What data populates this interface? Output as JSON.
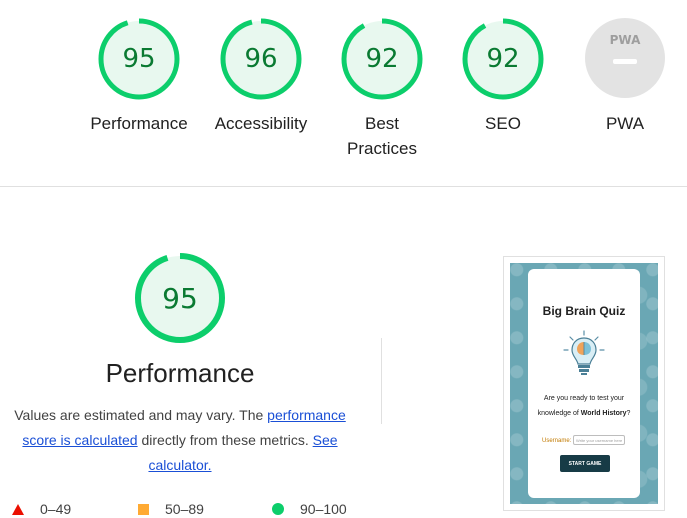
{
  "summary": {
    "gauges": [
      {
        "label": "Performance",
        "score": 95
      },
      {
        "label": "Accessibility",
        "score": 96
      },
      {
        "label": "Best Practices",
        "label_lines": [
          "Best",
          "Practices"
        ],
        "score": 92
      },
      {
        "label": "SEO",
        "score": 92
      }
    ],
    "pwa": {
      "badge_text": "PWA",
      "label": "PWA"
    }
  },
  "performance": {
    "score": 95,
    "title": "Performance",
    "desc_prefix": "Values are estimated and may vary. The ",
    "desc_link_text": "performance score is calculated",
    "desc_middle": " directly from these metrics. ",
    "calc_link_text": "See calculator.",
    "legend": [
      {
        "icon": "triangle-icon",
        "range": "0–49",
        "color": "#eb0f00"
      },
      {
        "icon": "square-icon",
        "range": "50–89",
        "color": "#ffaa33"
      },
      {
        "icon": "circle-icon",
        "range": "90–100",
        "color": "#0cce6b"
      }
    ]
  },
  "screenshot": {
    "title": "Big Brain Quiz",
    "question_prefix": "Are you ready to test your knowledge of ",
    "question_bold": "World History",
    "question_suffix": "?",
    "username_label": "Username:",
    "username_placeholder": "Write your username here",
    "start_label": "START GAME"
  },
  "colors": {
    "pass_green": "#0cce6b",
    "pass_text": "#0a7a32",
    "pass_bg": "#e8f8ef",
    "link": "#1a4fd6"
  }
}
